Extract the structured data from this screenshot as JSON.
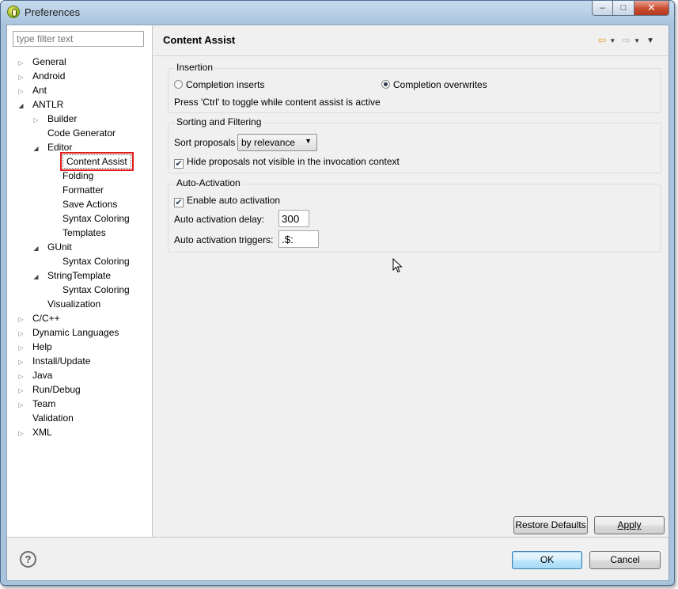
{
  "window": {
    "title": "Preferences"
  },
  "filter": {
    "placeholder": "type filter text"
  },
  "tree": [
    {
      "label": "General",
      "twisty": "collapsed"
    },
    {
      "label": "Android",
      "twisty": "collapsed"
    },
    {
      "label": "Ant",
      "twisty": "collapsed"
    },
    {
      "label": "ANTLR",
      "twisty": "expanded"
    },
    {
      "label": "Builder",
      "twisty": "collapsed"
    },
    {
      "label": "Code Generator",
      "twisty": "none"
    },
    {
      "label": "Editor",
      "twisty": "expanded"
    },
    {
      "label": "Content Assist",
      "twisty": "none",
      "selected": true
    },
    {
      "label": "Folding",
      "twisty": "none"
    },
    {
      "label": "Formatter",
      "twisty": "none"
    },
    {
      "label": "Save Actions",
      "twisty": "none"
    },
    {
      "label": "Syntax Coloring",
      "twisty": "none"
    },
    {
      "label": "Templates",
      "twisty": "none"
    },
    {
      "label": "GUnit",
      "twisty": "expanded"
    },
    {
      "label": "Syntax Coloring",
      "twisty": "none"
    },
    {
      "label": "StringTemplate",
      "twisty": "expanded"
    },
    {
      "label": "Syntax Coloring",
      "twisty": "none"
    },
    {
      "label": "Visualization",
      "twisty": "none"
    },
    {
      "label": "C/C++",
      "twisty": "collapsed"
    },
    {
      "label": "Dynamic Languages",
      "twisty": "collapsed"
    },
    {
      "label": "Help",
      "twisty": "collapsed"
    },
    {
      "label": "Install/Update",
      "twisty": "collapsed"
    },
    {
      "label": "Java",
      "twisty": "collapsed"
    },
    {
      "label": "Run/Debug",
      "twisty": "collapsed"
    },
    {
      "label": "Team",
      "twisty": "collapsed"
    },
    {
      "label": "Validation",
      "twisty": "none"
    },
    {
      "label": "XML",
      "twisty": "collapsed"
    }
  ],
  "page": {
    "title": "Content Assist",
    "insertion": {
      "label": "Insertion",
      "option_inserts": "Completion inserts",
      "option_overwrites": "Completion overwrites",
      "selected": "overwrites",
      "hint": "Press 'Ctrl' to toggle while content assist is active"
    },
    "sorting": {
      "label": "Sorting and Filtering",
      "sort_label": "Sort proposals",
      "sort_value": "by relevance",
      "hide_label": "Hide proposals not visible in the invocation context",
      "hide_checked": true
    },
    "auto": {
      "label": "Auto-Activation",
      "enable_label": "Enable auto activation",
      "enable_checked": true,
      "delay_label": "Auto activation delay:",
      "delay_value": "300",
      "triggers_label": "Auto activation triggers:",
      "triggers_value": ".$:"
    },
    "restore_defaults": "Restore Defaults",
    "apply": "Apply"
  },
  "buttons": {
    "ok": "OK",
    "cancel": "Cancel"
  },
  "colors": {
    "selection_highlight": "#e11c1c",
    "title_bar": "#aac3dd"
  }
}
